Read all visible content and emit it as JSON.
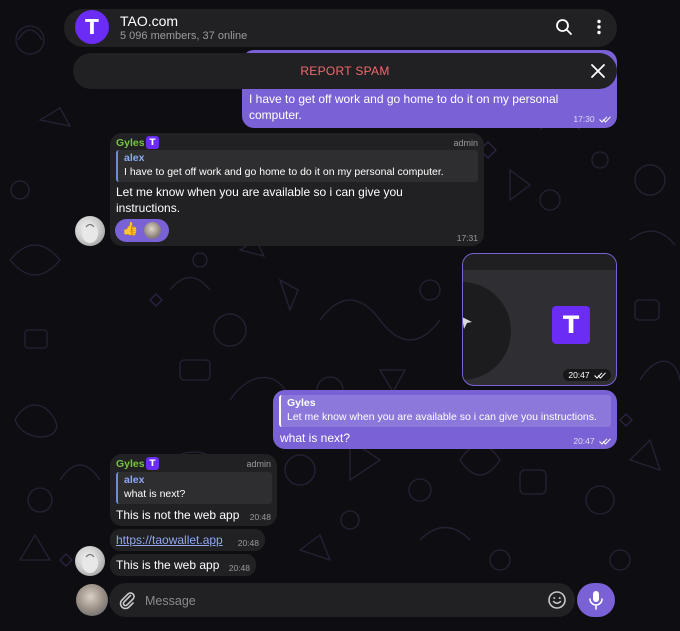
{
  "colors": {
    "accent": "#7a62d6",
    "brand": "#6b2cf5",
    "bubble_in": "#212124",
    "report_spam": "#f06a6a",
    "sender": "#76c442",
    "link": "#8ea9f0"
  },
  "header": {
    "title": "TAO.com",
    "subtitle": "5 096 members, 37 online",
    "avatar_letter": "T",
    "search_icon": "search-icon",
    "menu_icon": "more-vertical-icon"
  },
  "report_spam": {
    "label": "REPORT SPAM",
    "close_icon": "close-icon"
  },
  "messages": [
    {
      "direction": "out",
      "text": "I have to get off work and go home to do it on my personal computer.",
      "time": "17:30",
      "read": true
    },
    {
      "direction": "in",
      "sender": "Gyles",
      "badge": "T",
      "role": "admin",
      "quote_name": "alex",
      "quote_text": "I have to get off work and go home to do it on my personal computer.",
      "text": "Let me know when you are available so i can give you instructions.",
      "time": "17:31",
      "reactions": [
        "👍"
      ]
    },
    {
      "direction": "out",
      "media_logo_letter": "T",
      "time": "20:47",
      "read": true
    },
    {
      "direction": "out",
      "quote_name": "Gyles",
      "quote_text": "Let me know when you are available so i can give you instructions.",
      "text": "what is next?",
      "time": "20:47",
      "read": true
    },
    {
      "direction": "in",
      "sender": "Gyles",
      "badge": "T",
      "role": "admin",
      "quote_name": "alex",
      "quote_text": "what is next?",
      "text": "This is not the web app",
      "time": "20:48"
    },
    {
      "direction": "in",
      "link": "https://taowallet.app",
      "time": "20:48"
    },
    {
      "direction": "in",
      "text": "This is the web app",
      "time": "20:48"
    }
  ],
  "composer": {
    "placeholder": "Message",
    "attach_icon": "paperclip-icon",
    "emoji_icon": "emoji-icon",
    "mic_icon": "microphone-icon"
  }
}
